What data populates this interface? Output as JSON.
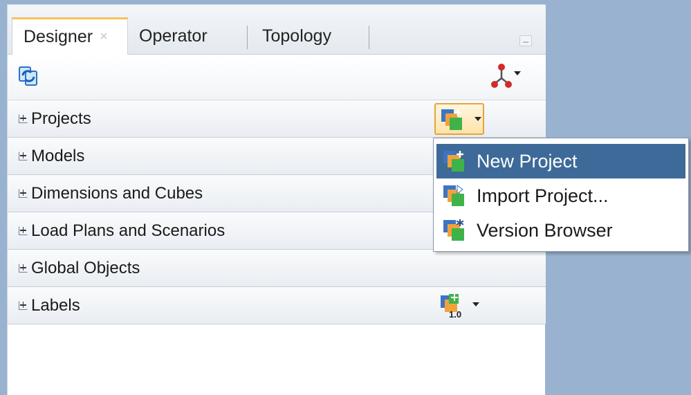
{
  "tabs": [
    {
      "label": "Designer",
      "active": true,
      "closable": true
    },
    {
      "label": "Operator",
      "active": false
    },
    {
      "label": "Topology",
      "active": false
    }
  ],
  "tab_close_glyph": "×",
  "toolbar": {
    "left_icon": "synchronize-icon",
    "right_icon": "connect-navigator-icon"
  },
  "accordion": [
    {
      "label": "Projects",
      "icon": "project-action-icon"
    },
    {
      "label": "Models"
    },
    {
      "label": "Dimensions and Cubes"
    },
    {
      "label": "Load Plans and Scenarios"
    },
    {
      "label": "Global Objects"
    },
    {
      "label": "Labels",
      "icon": "label-version-icon",
      "icon_text": "1.0"
    }
  ],
  "project_menu": {
    "items": [
      {
        "label": "New Project",
        "highlighted": true,
        "icon": "new-project-icon"
      },
      {
        "label": "Import Project...",
        "highlighted": false,
        "icon": "import-project-icon"
      },
      {
        "label": "Version Browser",
        "highlighted": false,
        "icon": "version-browser-icon"
      }
    ]
  },
  "colors": {
    "background": "#98b2cf",
    "active_tab_accent": "#f6c35a",
    "menu_highlight": "#3d6a98",
    "button_highlight_border": "#e7a33a"
  }
}
